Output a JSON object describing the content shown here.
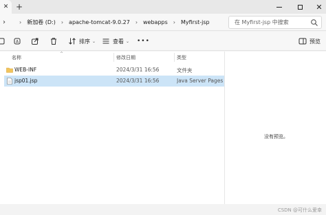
{
  "window": {
    "tab_close": "✕",
    "new_tab": "+",
    "close_glyph": "✕"
  },
  "address": {
    "crumbs": [
      "新加卷 (D:)",
      "apache-tomcat-9.0.27",
      "webapps",
      "Myfirst-jsp"
    ],
    "separator": "›",
    "search_placeholder": "在 Myfirst-jsp 中搜索"
  },
  "toolbar": {
    "sort_label": "排序",
    "view_label": "查看",
    "more_label": "•••",
    "preview_label": "预览"
  },
  "columns": {
    "name": "名称",
    "date": "修改日期",
    "type": "类型"
  },
  "files": [
    {
      "name": "WEB-INF",
      "date": "2024/3/31 16:56",
      "type": "文件夹",
      "icon": "folder-icon",
      "selected": false
    },
    {
      "name": "jsp01.jsp",
      "date": "2024/3/31 16:56",
      "type": "Java Server Pages ...",
      "icon": "jsp-file-icon",
      "selected": true
    }
  ],
  "preview": {
    "empty_text": "没有预览。"
  },
  "watermark": "CSDN @可什么爱幸",
  "colors": {
    "selection": "#cce4f7",
    "folder": "#f2c55c",
    "accent": "#0067c0"
  }
}
